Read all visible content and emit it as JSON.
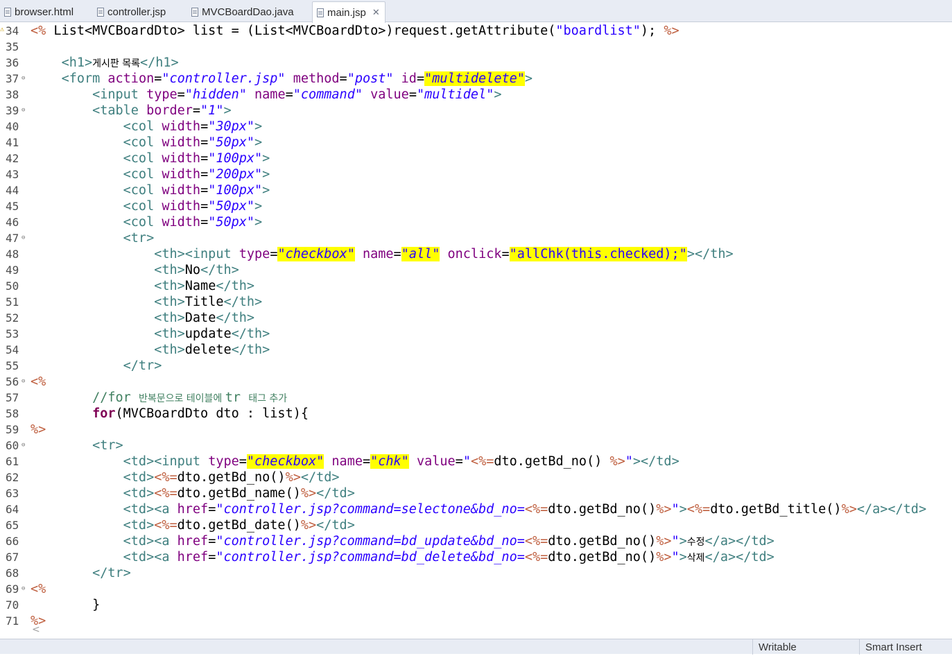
{
  "tabs": [
    {
      "label": "browser.html",
      "active": false
    },
    {
      "label": "controller.jsp",
      "active": false
    },
    {
      "label": "MVCBoardDao.java",
      "active": false
    },
    {
      "label": "main.jsp",
      "active": true,
      "close": "✕"
    }
  ],
  "editor": {
    "lines": [
      {
        "n": "34",
        "warn": true,
        "segs": [
          [
            "d",
            "<%"
          ],
          [
            "k",
            " List<MVCBoardDto> list = (List<MVCBoardDto>)request.getAttribute("
          ],
          [
            "s",
            "\"boardlist\""
          ],
          [
            "k",
            "); "
          ],
          [
            "d",
            "%>"
          ]
        ]
      },
      {
        "n": "35",
        "segs": []
      },
      {
        "n": "36",
        "segs": [
          [
            "k",
            "    "
          ],
          [
            "t",
            "<h1>"
          ],
          [
            "ko",
            "게시판 목록"
          ],
          [
            "t",
            "</h1>"
          ]
        ]
      },
      {
        "n": "37",
        "fold": true,
        "segs": [
          [
            "k",
            "    "
          ],
          [
            "t",
            "<form "
          ],
          [
            "a",
            "action"
          ],
          [
            "k",
            "="
          ],
          [
            "v",
            "\"controller.jsp\""
          ],
          [
            "k",
            " "
          ],
          [
            "a",
            "method"
          ],
          [
            "k",
            "="
          ],
          [
            "v",
            "\"post\""
          ],
          [
            "k",
            " "
          ],
          [
            "a",
            "id"
          ],
          [
            "k",
            "="
          ],
          [
            "vh",
            "\"multidelete\""
          ],
          [
            "t",
            ">"
          ]
        ]
      },
      {
        "n": "38",
        "segs": [
          [
            "k",
            "        "
          ],
          [
            "t",
            "<input "
          ],
          [
            "a",
            "type"
          ],
          [
            "k",
            "="
          ],
          [
            "v",
            "\"hidden\""
          ],
          [
            "k",
            " "
          ],
          [
            "a",
            "name"
          ],
          [
            "k",
            "="
          ],
          [
            "v",
            "\"command\""
          ],
          [
            "k",
            " "
          ],
          [
            "a",
            "value"
          ],
          [
            "k",
            "="
          ],
          [
            "v",
            "\"multidel\""
          ],
          [
            "t",
            ">"
          ]
        ]
      },
      {
        "n": "39",
        "fold": true,
        "segs": [
          [
            "k",
            "        "
          ],
          [
            "t",
            "<table "
          ],
          [
            "a",
            "border"
          ],
          [
            "k",
            "="
          ],
          [
            "v",
            "\"1\""
          ],
          [
            "t",
            ">"
          ]
        ]
      },
      {
        "n": "40",
        "segs": [
          [
            "k",
            "            "
          ],
          [
            "t",
            "<col "
          ],
          [
            "a",
            "width"
          ],
          [
            "k",
            "="
          ],
          [
            "v",
            "\"30px\""
          ],
          [
            "t",
            ">"
          ]
        ]
      },
      {
        "n": "41",
        "segs": [
          [
            "k",
            "            "
          ],
          [
            "t",
            "<col "
          ],
          [
            "a",
            "width"
          ],
          [
            "k",
            "="
          ],
          [
            "v",
            "\"50px\""
          ],
          [
            "t",
            ">"
          ]
        ]
      },
      {
        "n": "42",
        "segs": [
          [
            "k",
            "            "
          ],
          [
            "t",
            "<col "
          ],
          [
            "a",
            "width"
          ],
          [
            "k",
            "="
          ],
          [
            "v",
            "\"100px\""
          ],
          [
            "t",
            ">"
          ]
        ]
      },
      {
        "n": "43",
        "segs": [
          [
            "k",
            "            "
          ],
          [
            "t",
            "<col "
          ],
          [
            "a",
            "width"
          ],
          [
            "k",
            "="
          ],
          [
            "v",
            "\"200px\""
          ],
          [
            "t",
            ">"
          ]
        ]
      },
      {
        "n": "44",
        "segs": [
          [
            "k",
            "            "
          ],
          [
            "t",
            "<col "
          ],
          [
            "a",
            "width"
          ],
          [
            "k",
            "="
          ],
          [
            "v",
            "\"100px\""
          ],
          [
            "t",
            ">"
          ]
        ]
      },
      {
        "n": "45",
        "segs": [
          [
            "k",
            "            "
          ],
          [
            "t",
            "<col "
          ],
          [
            "a",
            "width"
          ],
          [
            "k",
            "="
          ],
          [
            "v",
            "\"50px\""
          ],
          [
            "t",
            ">"
          ]
        ]
      },
      {
        "n": "46",
        "segs": [
          [
            "k",
            "            "
          ],
          [
            "t",
            "<col "
          ],
          [
            "a",
            "width"
          ],
          [
            "k",
            "="
          ],
          [
            "v",
            "\"50px\""
          ],
          [
            "t",
            ">"
          ]
        ]
      },
      {
        "n": "47",
        "fold": true,
        "segs": [
          [
            "k",
            "            "
          ],
          [
            "t",
            "<tr>"
          ]
        ]
      },
      {
        "n": "48",
        "segs": [
          [
            "k",
            "                "
          ],
          [
            "t",
            "<th><input "
          ],
          [
            "a",
            "type"
          ],
          [
            "k",
            "="
          ],
          [
            "vh",
            "\"checkbox\""
          ],
          [
            "k",
            " "
          ],
          [
            "a",
            "name"
          ],
          [
            "k",
            "="
          ],
          [
            "vh",
            "\"all\""
          ],
          [
            "k",
            " "
          ],
          [
            "a",
            "onclick"
          ],
          [
            "k",
            "="
          ],
          [
            "sh",
            "\"allChk(this.checked);\""
          ],
          [
            "t",
            "></th>"
          ]
        ]
      },
      {
        "n": "49",
        "segs": [
          [
            "k",
            "                "
          ],
          [
            "t",
            "<th>"
          ],
          [
            "k",
            "No"
          ],
          [
            "t",
            "</th>"
          ]
        ]
      },
      {
        "n": "50",
        "segs": [
          [
            "k",
            "                "
          ],
          [
            "t",
            "<th>"
          ],
          [
            "k",
            "Name"
          ],
          [
            "t",
            "</th>"
          ]
        ]
      },
      {
        "n": "51",
        "segs": [
          [
            "k",
            "                "
          ],
          [
            "t",
            "<th>"
          ],
          [
            "k",
            "Title"
          ],
          [
            "t",
            "</th>"
          ]
        ]
      },
      {
        "n": "52",
        "segs": [
          [
            "k",
            "                "
          ],
          [
            "t",
            "<th>"
          ],
          [
            "k",
            "Date"
          ],
          [
            "t",
            "</th>"
          ]
        ]
      },
      {
        "n": "53",
        "segs": [
          [
            "k",
            "                "
          ],
          [
            "t",
            "<th>"
          ],
          [
            "k",
            "update"
          ],
          [
            "t",
            "</th>"
          ]
        ]
      },
      {
        "n": "54",
        "segs": [
          [
            "k",
            "                "
          ],
          [
            "t",
            "<th>"
          ],
          [
            "k",
            "delete"
          ],
          [
            "t",
            "</th>"
          ]
        ]
      },
      {
        "n": "55",
        "segs": [
          [
            "k",
            "            "
          ],
          [
            "t",
            "</tr>"
          ]
        ]
      },
      {
        "n": "56",
        "fold": true,
        "segs": [
          [
            "d",
            "<%"
          ]
        ]
      },
      {
        "n": "57",
        "segs": [
          [
            "k",
            "        "
          ],
          [
            "c",
            "//for "
          ],
          [
            "cko",
            "반복문으로 테이블에 "
          ],
          [
            "c",
            "tr "
          ],
          [
            "cko",
            "태그 추가"
          ]
        ]
      },
      {
        "n": "58",
        "segs": [
          [
            "k",
            "        "
          ],
          [
            "kw",
            "for"
          ],
          [
            "k",
            "(MVCBoardDto dto : list){"
          ]
        ]
      },
      {
        "n": "59",
        "segs": [
          [
            "d",
            "%>"
          ]
        ]
      },
      {
        "n": "60",
        "fold": true,
        "segs": [
          [
            "k",
            "        "
          ],
          [
            "t",
            "<tr>"
          ]
        ]
      },
      {
        "n": "61",
        "segs": [
          [
            "k",
            "            "
          ],
          [
            "t",
            "<td><input "
          ],
          [
            "a",
            "type"
          ],
          [
            "k",
            "="
          ],
          [
            "vh",
            "\"checkbox\""
          ],
          [
            "k",
            " "
          ],
          [
            "a",
            "name"
          ],
          [
            "k",
            "="
          ],
          [
            "vh",
            "\"chk\""
          ],
          [
            "k",
            " "
          ],
          [
            "a",
            "value"
          ],
          [
            "k",
            "="
          ],
          [
            "s",
            "\""
          ],
          [
            "d",
            "<%="
          ],
          [
            "k",
            "dto.getBd_no() "
          ],
          [
            "d",
            "%>"
          ],
          [
            "s",
            "\""
          ],
          [
            "t",
            "></td>"
          ]
        ]
      },
      {
        "n": "62",
        "segs": [
          [
            "k",
            "            "
          ],
          [
            "t",
            "<td>"
          ],
          [
            "d",
            "<%="
          ],
          [
            "k",
            "dto.getBd_no()"
          ],
          [
            "d",
            "%>"
          ],
          [
            "t",
            "</td>"
          ]
        ]
      },
      {
        "n": "63",
        "segs": [
          [
            "k",
            "            "
          ],
          [
            "t",
            "<td>"
          ],
          [
            "d",
            "<%="
          ],
          [
            "k",
            "dto.getBd_name()"
          ],
          [
            "d",
            "%>"
          ],
          [
            "t",
            "</td>"
          ]
        ]
      },
      {
        "n": "64",
        "segs": [
          [
            "k",
            "            "
          ],
          [
            "t",
            "<td><a "
          ],
          [
            "a",
            "href"
          ],
          [
            "k",
            "="
          ],
          [
            "v",
            "\"controller.jsp?command=selectone&bd_no="
          ],
          [
            "d",
            "<%="
          ],
          [
            "k",
            "dto.getBd_no()"
          ],
          [
            "d",
            "%>"
          ],
          [
            "s",
            "\""
          ],
          [
            "t",
            ">"
          ],
          [
            "d",
            "<%="
          ],
          [
            "k",
            "dto.getBd_title()"
          ],
          [
            "d",
            "%>"
          ],
          [
            "t",
            "</a></td>"
          ]
        ]
      },
      {
        "n": "65",
        "segs": [
          [
            "k",
            "            "
          ],
          [
            "t",
            "<td>"
          ],
          [
            "d",
            "<%="
          ],
          [
            "k",
            "dto.getBd_date()"
          ],
          [
            "d",
            "%>"
          ],
          [
            "t",
            "</td>"
          ]
        ]
      },
      {
        "n": "66",
        "segs": [
          [
            "k",
            "            "
          ],
          [
            "t",
            "<td><a "
          ],
          [
            "a",
            "href"
          ],
          [
            "k",
            "="
          ],
          [
            "v",
            "\"controller.jsp?command=bd_update&bd_no="
          ],
          [
            "d",
            "<%="
          ],
          [
            "k",
            "dto.getBd_no()"
          ],
          [
            "d",
            "%>"
          ],
          [
            "s",
            "\""
          ],
          [
            "t",
            ">"
          ],
          [
            "ko",
            "수정"
          ],
          [
            "t",
            "</a></td>"
          ]
        ]
      },
      {
        "n": "67",
        "segs": [
          [
            "k",
            "            "
          ],
          [
            "t",
            "<td><a "
          ],
          [
            "a",
            "href"
          ],
          [
            "k",
            "="
          ],
          [
            "v",
            "\"controller.jsp?command=bd_delete&bd_no="
          ],
          [
            "d",
            "<%="
          ],
          [
            "k",
            "dto.getBd_no()"
          ],
          [
            "d",
            "%>"
          ],
          [
            "s",
            "\""
          ],
          [
            "t",
            ">"
          ],
          [
            "ko",
            "삭제"
          ],
          [
            "t",
            "</a></td>"
          ]
        ]
      },
      {
        "n": "68",
        "segs": [
          [
            "k",
            "        "
          ],
          [
            "t",
            "</tr>"
          ]
        ]
      },
      {
        "n": "69",
        "fold": true,
        "segs": [
          [
            "d",
            "<%"
          ]
        ]
      },
      {
        "n": "70",
        "segs": [
          [
            "k",
            "        }"
          ]
        ]
      },
      {
        "n": "71",
        "segs": [
          [
            "d",
            "%>"
          ]
        ]
      }
    ]
  },
  "scrollbar": {
    "left_arrow": "<"
  },
  "status": {
    "writable": "Writable",
    "insert_mode": "Smart Insert"
  },
  "colors": {
    "tag": "#3f7f7f",
    "attribute": "#7f007f",
    "value": "#2a00ff",
    "jsp_delimiter": "#bf5f3f",
    "comment": "#3f7f5f",
    "keyword": "#7f0055",
    "highlight": "#ffff00"
  }
}
